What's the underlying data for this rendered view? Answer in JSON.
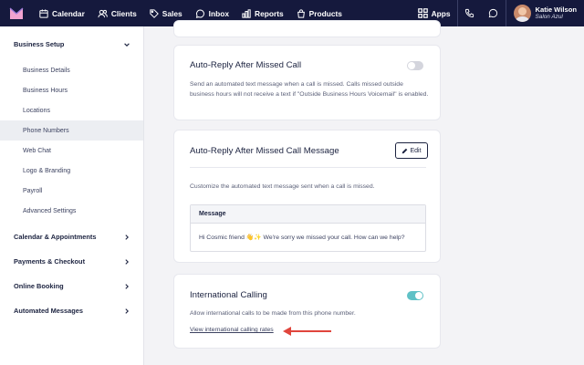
{
  "nav": {
    "items": [
      {
        "label": "Calendar",
        "icon": "calendar-icon"
      },
      {
        "label": "Clients",
        "icon": "users-icon"
      },
      {
        "label": "Sales",
        "icon": "tag-icon"
      },
      {
        "label": "Inbox",
        "icon": "chat-icon"
      },
      {
        "label": "Reports",
        "icon": "bar-chart-icon"
      },
      {
        "label": "Products",
        "icon": "bag-icon"
      }
    ],
    "apps_label": "Apps",
    "user_name": "Katie Wilson",
    "user_business": "Salon Azul",
    "colors": {
      "bar": "#15193d",
      "logo": "#f2a3d0"
    }
  },
  "sidebar": {
    "sections": [
      {
        "label": "Business Setup",
        "expanded": true,
        "items": [
          {
            "label": "Business Details"
          },
          {
            "label": "Business Hours"
          },
          {
            "label": "Locations"
          },
          {
            "label": "Phone Numbers",
            "active": true
          },
          {
            "label": "Web Chat"
          },
          {
            "label": "Logo & Branding"
          },
          {
            "label": "Payroll"
          },
          {
            "label": "Advanced Settings"
          }
        ]
      },
      {
        "label": "Calendar & Appointments",
        "expanded": false
      },
      {
        "label": "Payments & Checkout",
        "expanded": false
      },
      {
        "label": "Online Booking",
        "expanded": false
      },
      {
        "label": "Automated Messages",
        "expanded": false
      }
    ]
  },
  "auto_reply": {
    "title": "Auto-Reply After Missed Call",
    "description": "Send an automated text message when a call is missed. Calls missed outside business hours will not receive a text if \"Outside Business Hours Voicemail\" is enabled.",
    "enabled": false
  },
  "auto_reply_message": {
    "title": "Auto-Reply After Missed Call Message",
    "edit_label": "Edit",
    "description": "Customize the automated text message sent when a call is missed.",
    "message_header": "Message",
    "message_body": "Hi Cosmic friend 👋✨ We're sorry we missed your call. How can we help?"
  },
  "international": {
    "title": "International Calling",
    "description": "Allow international calls to be made from this phone number.",
    "link_text": "View international calling rates",
    "enabled": true,
    "toggle_on_color": "#5fc1c6",
    "toggle_off_color": "#d4d5dd",
    "arrow_color": "#e0453c"
  }
}
